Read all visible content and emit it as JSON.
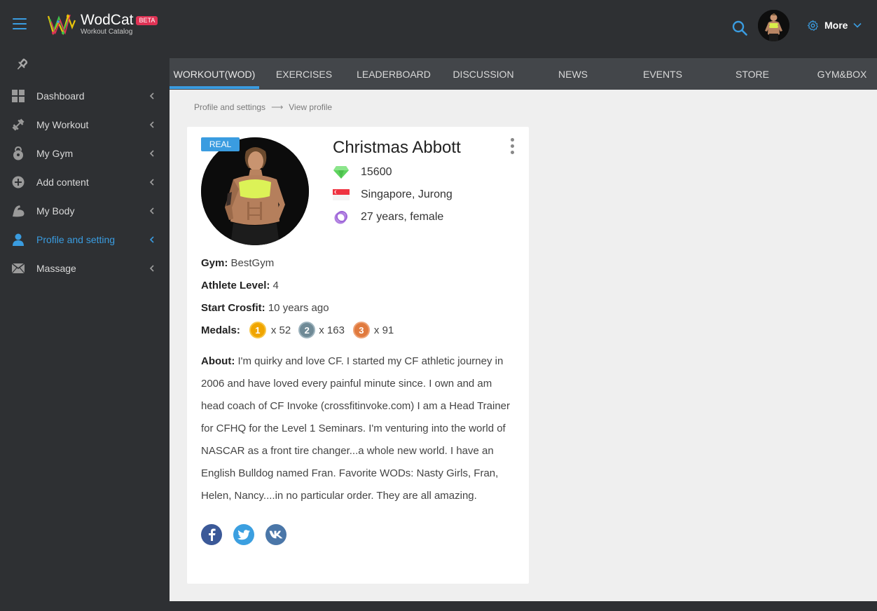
{
  "header": {
    "logo_name": "WodCat",
    "logo_badge": "BETA",
    "logo_sub": "Workout Catalog",
    "more_label": "More"
  },
  "sidebar": {
    "items": [
      {
        "label": "Dashboard",
        "icon": "dashboard-icon"
      },
      {
        "label": "My Workout",
        "icon": "dumbbell-icon"
      },
      {
        "label": "My Gym",
        "icon": "kettlebell-icon"
      },
      {
        "label": "Add content",
        "icon": "plus-circle-icon"
      },
      {
        "label": "My Body",
        "icon": "bicep-icon"
      },
      {
        "label": "Profile and setting",
        "icon": "user-icon",
        "active": true
      },
      {
        "label": "Massage",
        "icon": "envelope-icon"
      }
    ]
  },
  "tabs": [
    "WORKOUT(WOD)",
    "EXERCISES",
    "LEADERBOARD",
    "DISCUSSION",
    "NEWS",
    "EVENTS",
    "STORE",
    "GYM&BOX"
  ],
  "breadcrumb": {
    "parent": "Profile and settings",
    "current": "View profile"
  },
  "profile": {
    "badge": "REAL",
    "name": "Christmas Abbott",
    "points": "15600",
    "location": "Singapore, Jurong",
    "age_gender": "27 years, female",
    "gym_label": "Gym:",
    "gym": "BestGym",
    "level_label": "Athlete Level:",
    "level": "4",
    "start_label": "Start Crosfit:",
    "start": "10 years ago",
    "medals_label": "Medals:",
    "medals": [
      {
        "rank": "1",
        "count": "x 52",
        "color": "#f0a500"
      },
      {
        "rank": "2",
        "count": "x 163",
        "color": "#6f8a96"
      },
      {
        "rank": "3",
        "count": "x 91",
        "color": "#e07a3e"
      }
    ],
    "about_label": "About:",
    "about": "I'm quirky and love CF. I started my CF athletic journey in 2006 and have loved every painful minute since. I own and am head coach of CF Invoke (crossfitinvoke.com) I am a Head Trainer for CFHQ for the Level 1 Seminars. I'm venturing into the world of NASCAR as a front tire changer...a whole new world. I have an English Bulldog named Fran. Favorite WODs: Nasty Girls, Fran, Helen, Nancy....in no particular order. They are all amazing."
  },
  "colors": {
    "accent": "#3a9ce0",
    "sidebar_bg": "#2e3033",
    "tabs_bg": "#43464a",
    "content_bg": "#efefef",
    "beta": "#e03355"
  }
}
